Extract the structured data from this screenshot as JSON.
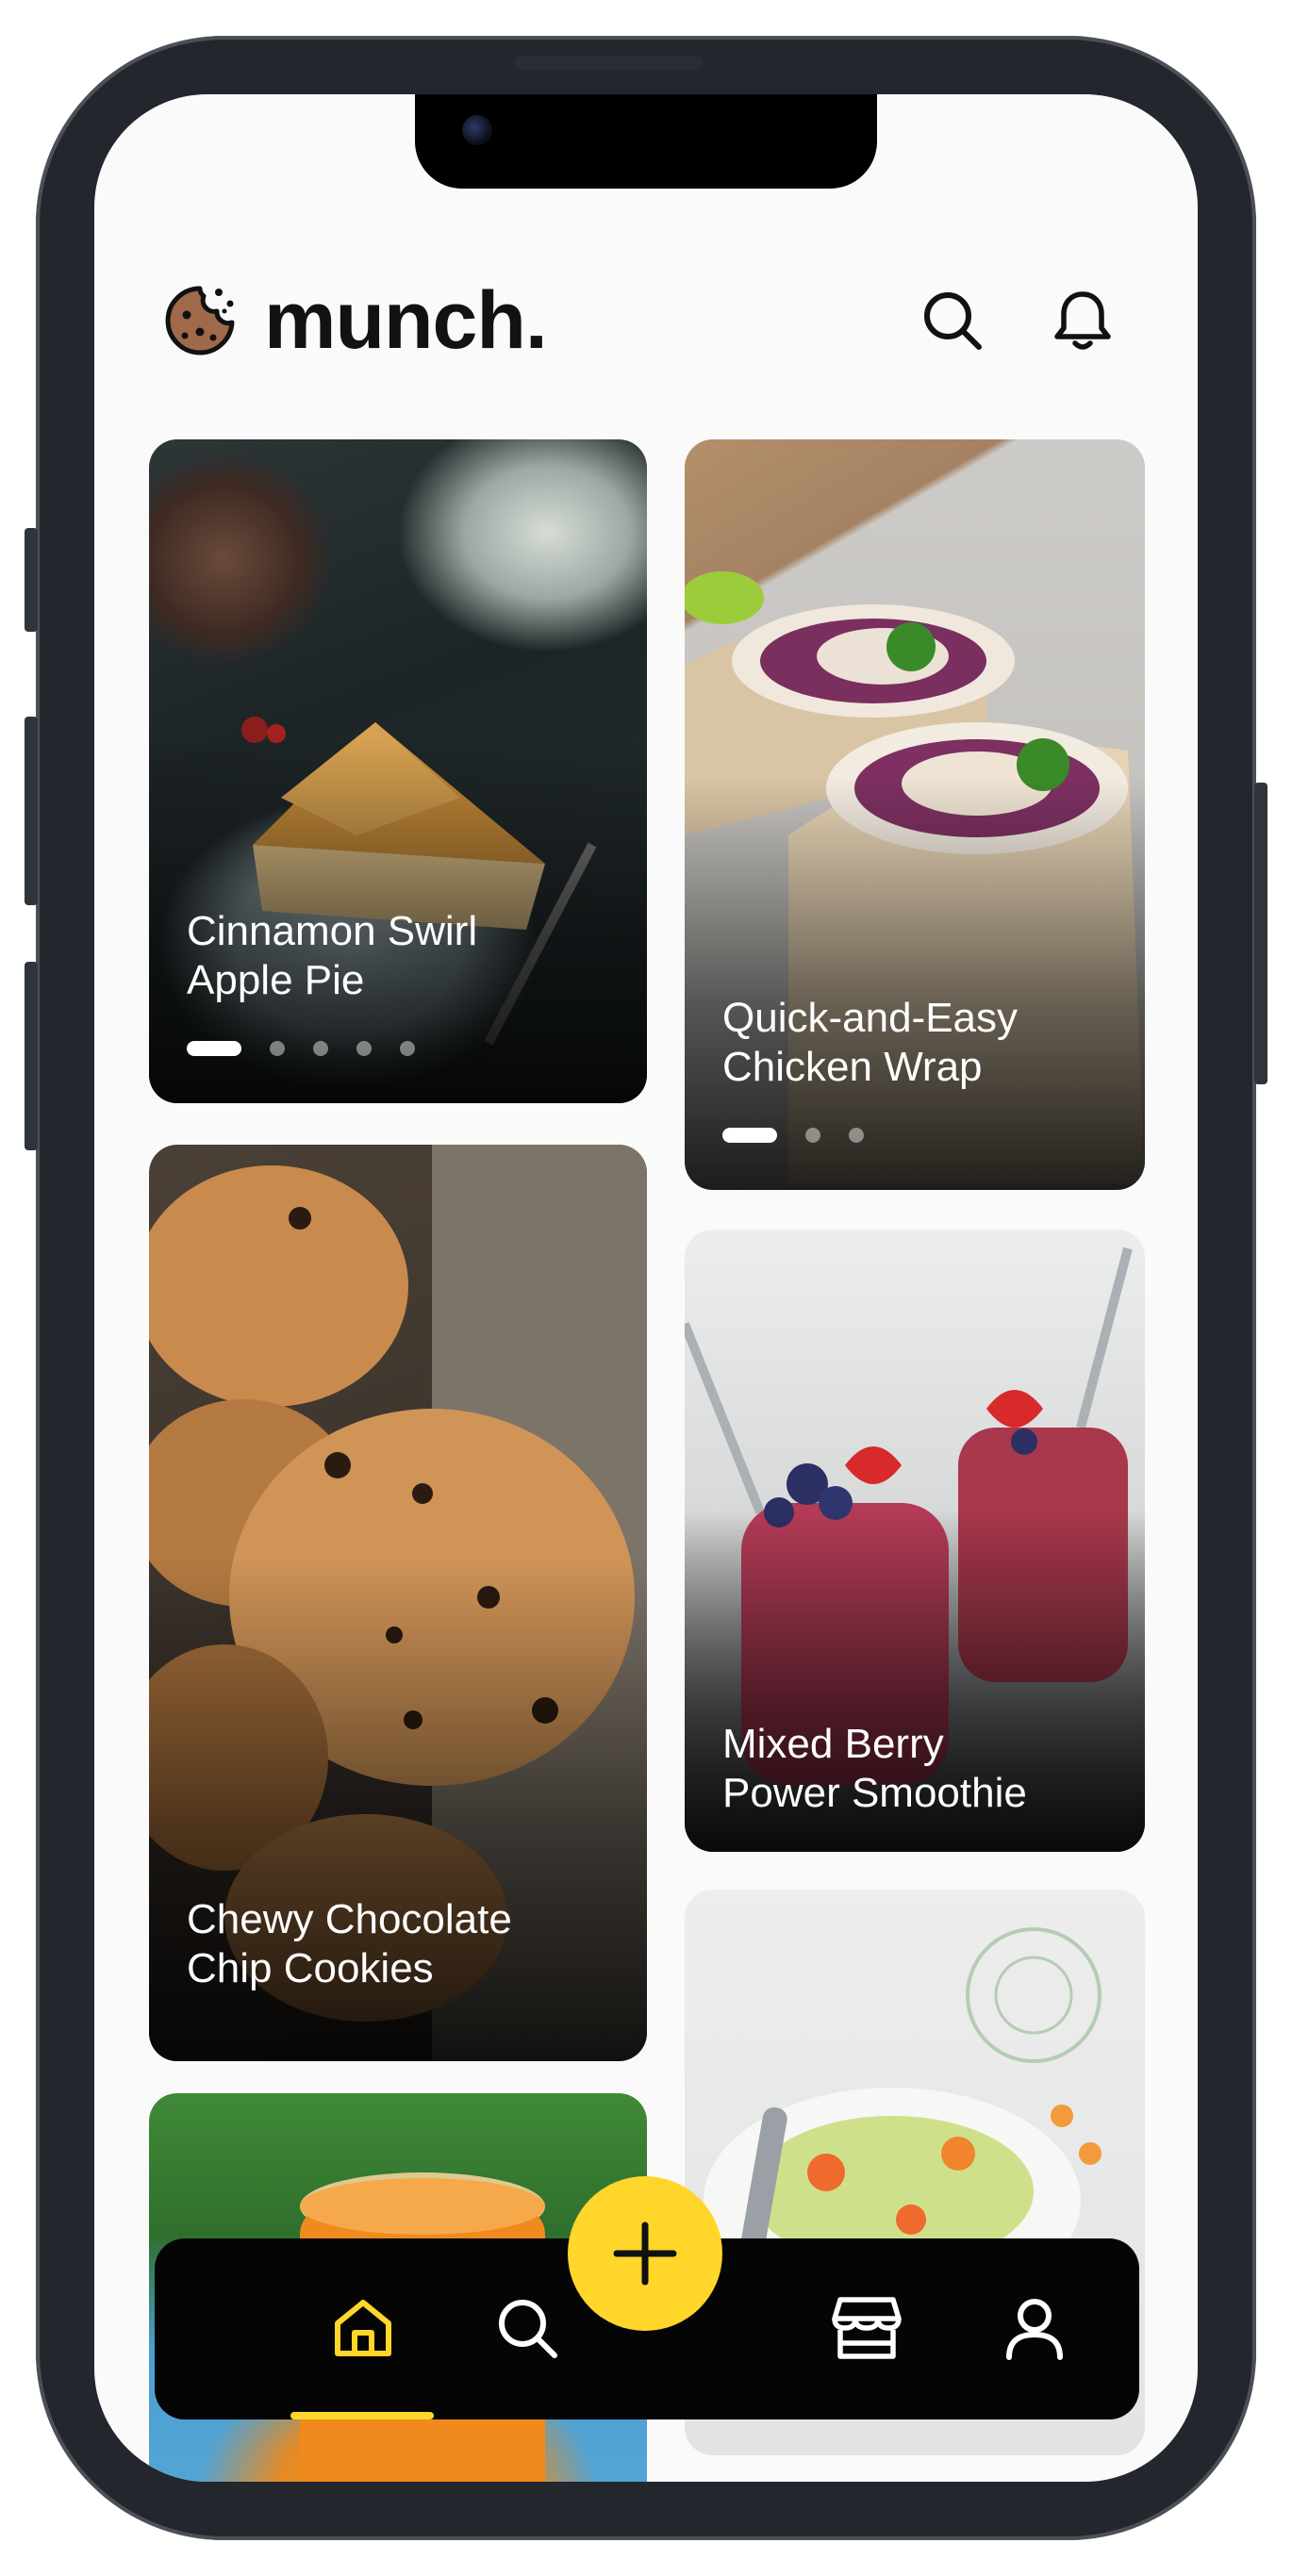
{
  "app": {
    "title": "munch."
  },
  "header": {
    "search_icon": "search-icon",
    "notification_icon": "bell-icon"
  },
  "recipes": [
    {
      "title": "Cinnamon Swirl\nApple Pie",
      "pages": 5,
      "active_page": 1
    },
    {
      "title": "Quick-and-Easy\nChicken Wrap",
      "pages": 3,
      "active_page": 1
    },
    {
      "title": "Chewy Chocolate\nChip Cookies"
    },
    {
      "title": "Mixed Berry\nPower Smoothie"
    },
    {
      "title": ""
    },
    {
      "title": ""
    }
  ],
  "bottom_nav": {
    "items": [
      {
        "name": "home",
        "icon": "home-icon",
        "active": true
      },
      {
        "name": "search",
        "icon": "search-icon",
        "active": false
      },
      {
        "name": "shop",
        "icon": "store-icon",
        "active": false
      },
      {
        "name": "profile",
        "icon": "user-icon",
        "active": false
      }
    ],
    "fab_icon": "plus-icon"
  },
  "colors": {
    "accent": "#ffd629",
    "text_dark": "#121212",
    "nav_background": "#050505",
    "page_background": "#fafafa"
  }
}
